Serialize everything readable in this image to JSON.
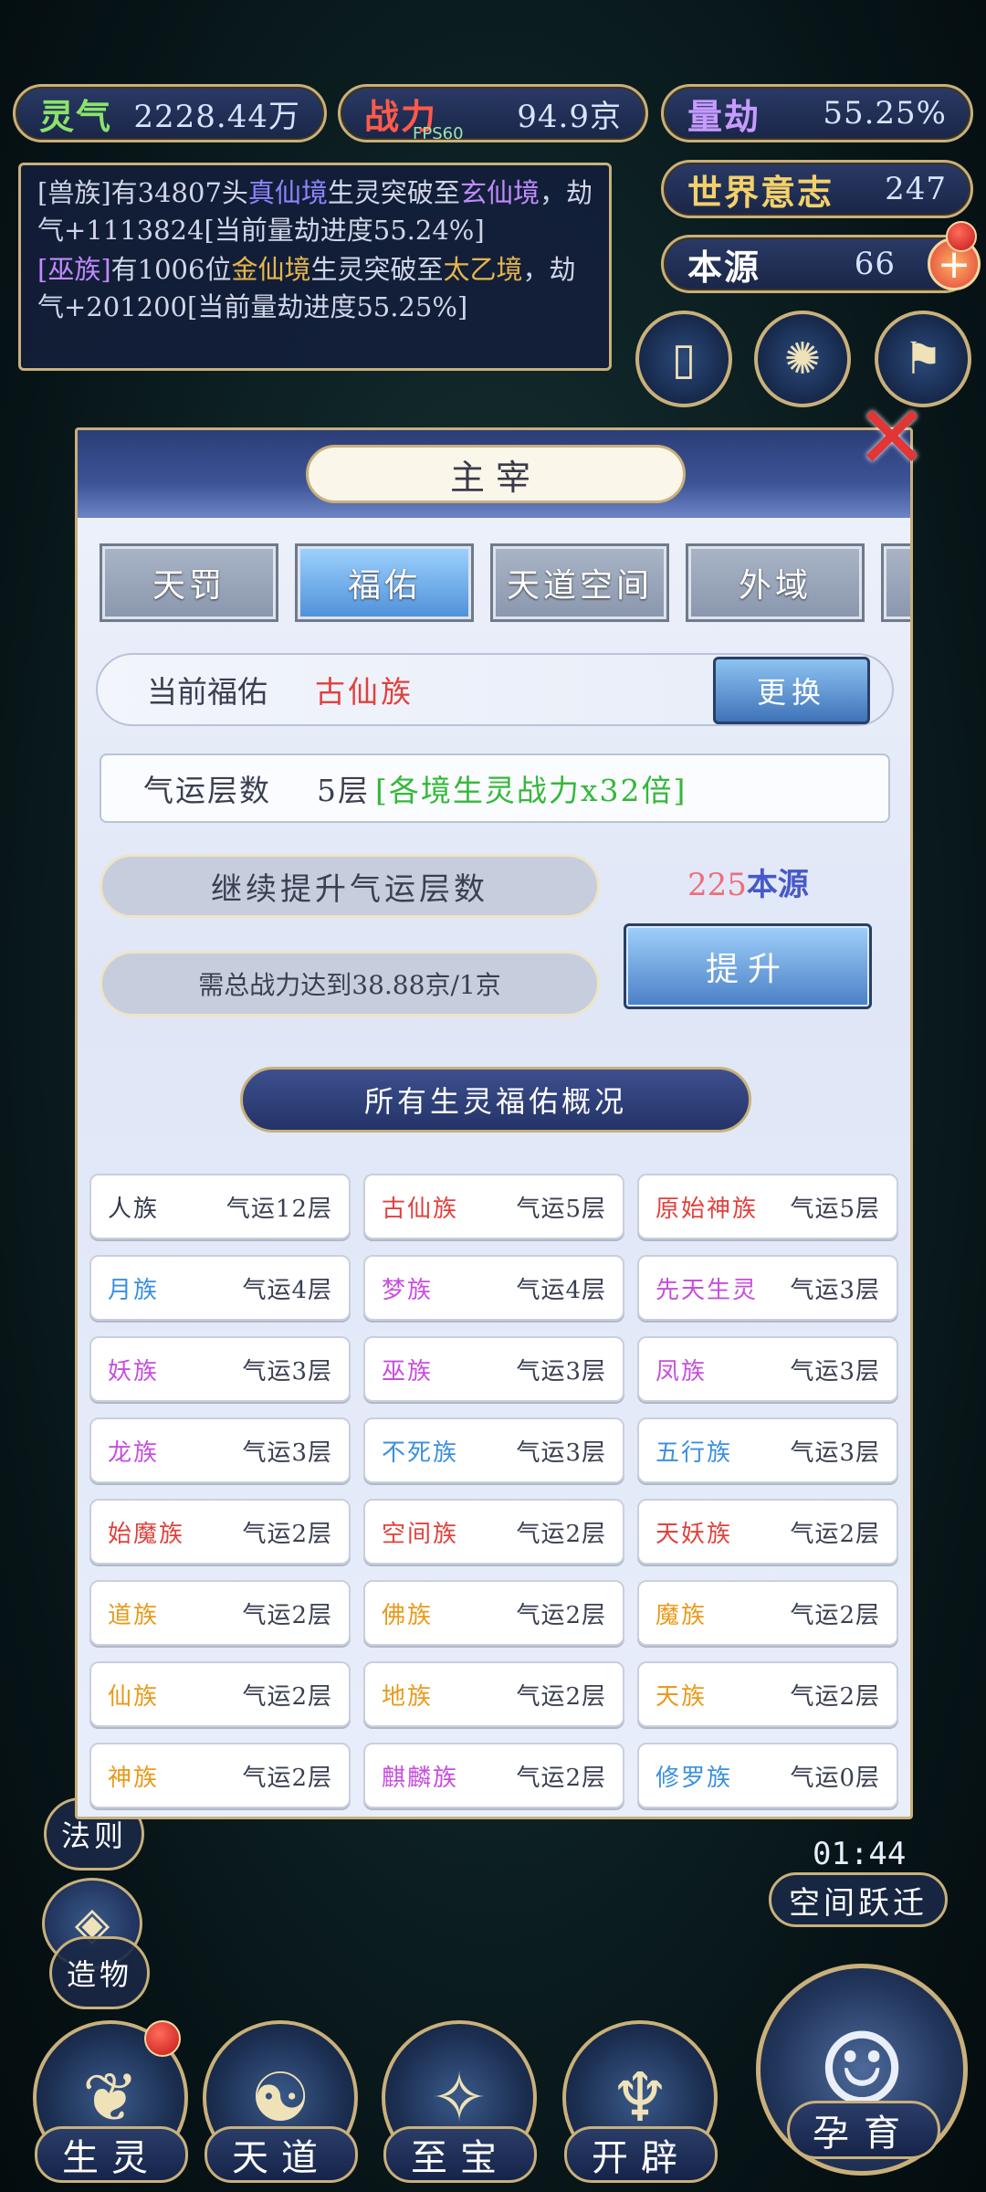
{
  "stats": {
    "lingqi": {
      "label": "灵气",
      "value": "2228.44万",
      "color": "#8be36b"
    },
    "zhanli": {
      "label": "战力",
      "value": "94.9京",
      "color": "#ff5a4a"
    },
    "liangjie": {
      "label": "量劫",
      "value": "55.25%",
      "color": "#c79bff"
    },
    "shijie": {
      "label": "世界意志",
      "value": "247",
      "color": "#f3d16a"
    },
    "benyuan": {
      "label": "本源",
      "value": "66",
      "color": "#ffffff"
    }
  },
  "fps": "FPS60",
  "log": {
    "msg1": {
      "tag": "[兽族]",
      "pre": "有34807头",
      "realm1": "真仙境",
      "mid": "生灵突破至",
      "realm2": "玄仙境",
      "post": "，劫气+1113824[当前量劫进度55.24%]"
    },
    "msg2": {
      "tag": "[巫族]",
      "pre": "有1006位",
      "realm1": "金仙境",
      "mid": "生灵突破至",
      "realm2": "太乙境",
      "post": "，劫气+201200[当前量劫进度55.25%]"
    }
  },
  "panel": {
    "title": "主宰",
    "tabs": [
      "天罚",
      "福佑",
      "天道空间",
      "外域"
    ],
    "active_tab": "福佑",
    "current_label": "当前福佑",
    "current_value": "古仙族",
    "swap_label": "更换",
    "luck_label": "气运层数",
    "luck_level": "5层",
    "luck_effect": "[各境生灵战力x32倍]",
    "continue_label": "继续提升气运层数",
    "require_label": "需总战力达到38.88京/1京",
    "cost_num": "225",
    "cost_unit": "本源",
    "upgrade_label": "提升",
    "section_title": "所有生灵福佑概况",
    "races": [
      {
        "name": "人族",
        "level": "气运12层",
        "color": "#333a4c"
      },
      {
        "name": "古仙族",
        "level": "气运5层",
        "color": "#e0413d"
      },
      {
        "name": "原始神族",
        "level": "气运5层",
        "color": "#e0413d"
      },
      {
        "name": "月族",
        "level": "气运4层",
        "color": "#3a8fe0"
      },
      {
        "name": "梦族",
        "level": "气运4层",
        "color": "#c84de0"
      },
      {
        "name": "先天生灵",
        "level": "气运3层",
        "color": "#c84de0"
      },
      {
        "name": "妖族",
        "level": "气运3层",
        "color": "#c84de0"
      },
      {
        "name": "巫族",
        "level": "气运3层",
        "color": "#c84de0"
      },
      {
        "name": "凤族",
        "level": "气运3层",
        "color": "#c84de0"
      },
      {
        "name": "龙族",
        "level": "气运3层",
        "color": "#c84de0"
      },
      {
        "name": "不死族",
        "level": "气运3层",
        "color": "#3a8fe0"
      },
      {
        "name": "五行族",
        "level": "气运3层",
        "color": "#3a8fe0"
      },
      {
        "name": "始魔族",
        "level": "气运2层",
        "color": "#e0413d"
      },
      {
        "name": "空间族",
        "level": "气运2层",
        "color": "#e0413d"
      },
      {
        "name": "天妖族",
        "level": "气运2层",
        "color": "#e0413d"
      },
      {
        "name": "道族",
        "level": "气运2层",
        "color": "#e89a1a"
      },
      {
        "name": "佛族",
        "level": "气运2层",
        "color": "#e89a1a"
      },
      {
        "name": "魔族",
        "level": "气运2层",
        "color": "#e89a1a"
      },
      {
        "name": "仙族",
        "level": "气运2层",
        "color": "#e89a1a"
      },
      {
        "name": "地族",
        "level": "气运2层",
        "color": "#e89a1a"
      },
      {
        "name": "天族",
        "level": "气运2层",
        "color": "#e89a1a"
      },
      {
        "name": "神族",
        "level": "气运2层",
        "color": "#e89a1a"
      },
      {
        "name": "麒麟族",
        "level": "气运2层",
        "color": "#c84de0"
      },
      {
        "name": "修罗族",
        "level": "气运0层",
        "color": "#3a8fe0"
      }
    ]
  },
  "side": {
    "fa_ze": "法则",
    "zao_wu": "造物",
    "timer": "01:44",
    "kongjian": "空间跃迁"
  },
  "nav": [
    "生灵",
    "天道",
    "至宝",
    "开辟"
  ],
  "nav_big": "孕育"
}
